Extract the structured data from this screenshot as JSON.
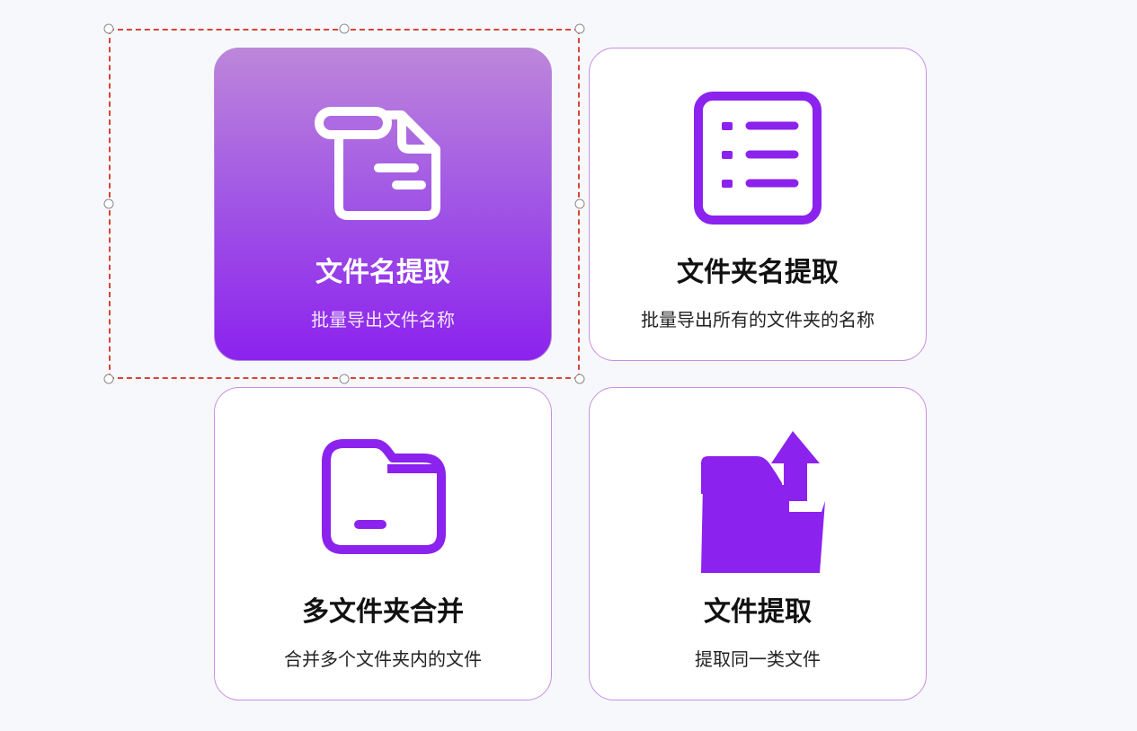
{
  "colors": {
    "accent": "#8c22ee",
    "accent_light": "#bd86da",
    "card_border": "#c98fe0",
    "selection": "#d6453b"
  },
  "cards": [
    {
      "title": "文件名提取",
      "desc": "批量导出文件名称",
      "icon": "file-icon",
      "selected": true
    },
    {
      "title": "文件夹名提取",
      "desc": "批量导出所有的文件夹的名称",
      "icon": "list-icon",
      "selected": false
    },
    {
      "title": "多文件夹合并",
      "desc": "合并多个文件夹内的文件",
      "icon": "folder-icon",
      "selected": false
    },
    {
      "title": "文件提取",
      "desc": "提取同一类文件",
      "icon": "folder-upload-icon",
      "selected": false
    }
  ]
}
